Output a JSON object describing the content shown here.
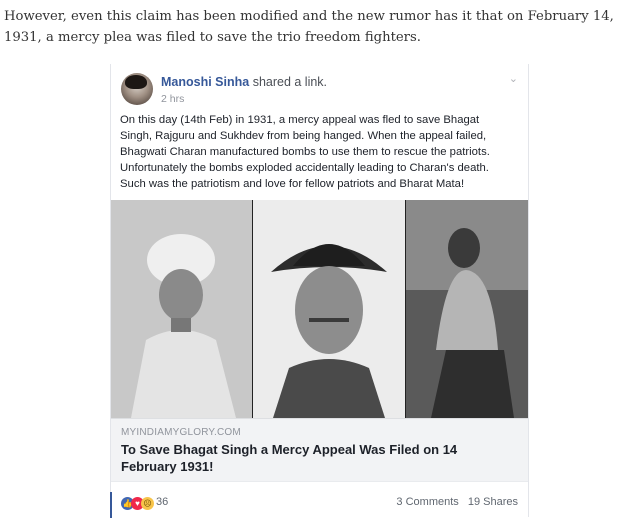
{
  "intro_text": "However, even this claim has been modified and the new rumor has it that on February 14, 1931, a mercy plea was filed to save the trio freedom fighters.",
  "post": {
    "author": "Manoshi Sinha",
    "action": "shared a link.",
    "time": "2 hrs",
    "text_lines": [
      "On this day (14th Feb) in 1931, a mercy appeal was fled to save Bhagat",
      "Singh, Rajguru and Sukhdev from being hanged. When the appeal failed,",
      "Bhagwati Charan manufactured bombs to use them to rescue the patriots.",
      "Unfortunately the bombs exploded accidentally leading to Charan's death.",
      "Such was the patriotism and love for fellow patriots and Bharat Mata!"
    ],
    "link": {
      "domain": "MYINDIAMYGLORY.COM",
      "title": "To Save Bhagat Singh a Mercy Appeal Was Filed on 14 February 1931!"
    },
    "reactions": {
      "icons": [
        "like-icon",
        "love-icon",
        "sad-icon"
      ],
      "count": "36"
    },
    "comments": "3 Comments",
    "shares": "19 Shares"
  }
}
